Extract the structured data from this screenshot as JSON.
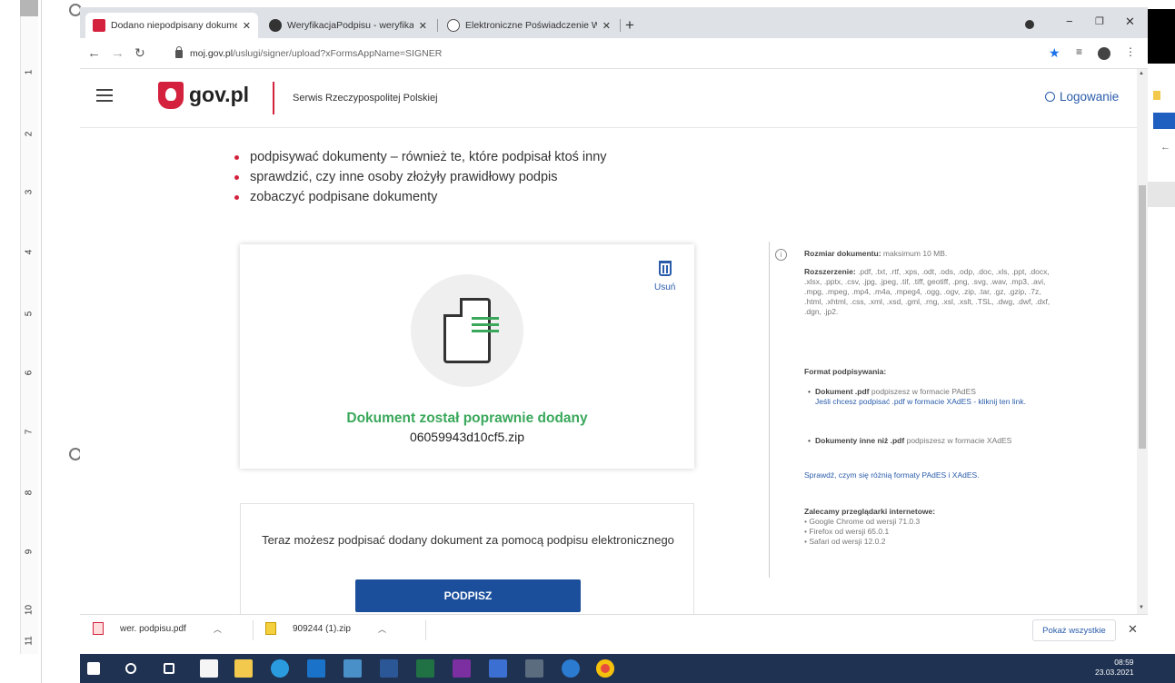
{
  "ruler": {
    "numbers": [
      "1",
      "2",
      "3",
      "4",
      "5",
      "6",
      "7",
      "8",
      "9",
      "10",
      "11"
    ]
  },
  "browser": {
    "tabs": [
      {
        "title": "Dodano niepodpisany dokument",
        "close": "✕",
        "favicon_color": "#d4213d"
      },
      {
        "title": "WeryfikacjaPodpisu - weryfikacja",
        "close": "✕",
        "favicon_color": "#333333"
      },
      {
        "title": "Elektroniczne Poświadczenie Wa",
        "close": "✕",
        "favicon_color": "#555555"
      }
    ],
    "new_tab": "+",
    "window_controls": {
      "minimize": "−",
      "maximize": "❐",
      "close": "✕"
    },
    "url_host": "moj.gov.pl",
    "url_path": "/uslugi/signer/upload?xFormsAppName=SIGNER"
  },
  "site": {
    "logo_text": "gov.pl",
    "subtitle": "Serwis Rzeczypospolitej Polskiej",
    "login_label": "Logowanie",
    "brand_red": "#d4213d",
    "link_blue": "#2a5caa"
  },
  "intro_bullets": [
    "podpisywać dokumenty – również te, które podpisał ktoś inny",
    "sprawdzić, czy inne osoby złożyły prawidłowy podpis",
    "zobaczyć podpisane dokumenty"
  ],
  "upload": {
    "delete_label": "Usuń",
    "success_text": "Dokument został poprawnie dodany",
    "file_name": "06059943d10cf5.zip",
    "success_color": "#3aa85b"
  },
  "sign": {
    "text": "Teraz możesz podpisać dodany dokument za pomocą podpisu elektronicznego",
    "button_label": "PODPISZ",
    "button_color": "#1b4f9b"
  },
  "info": {
    "size_label": "Rozmiar dokumentu:",
    "size_value": "maksimum 10 MB.",
    "ext_label": "Rozszerzenie:",
    "ext_value": ".pdf, .txt, .rtf, .xps, .odt, .ods, .odp, .doc, .xls, .ppt, .docx, .xlsx, .pptx, .csv, .jpg, .jpeg, .tif, .tiff, geotiff, .png, .svg, .wav, .mp3, .avi, .mpg, .mpeg, .mp4, .m4a, .mpeg4, .ogg, .ogv, .zip, .tar, .gz, .gzip, .7z, .html, .xhtml, .css, .xml, .xsd, .gml, .rng, .xsl, .xslt, .TSL, .dwg, .dwf, .dxf, .dgn, .jp2.",
    "format_title": "Format podpisywania:",
    "pdf_bold": "Dokument .pdf",
    "pdf_rest": "podpiszesz w formacie PAdES",
    "pdf_link": "Jeśli chcesz podpisać .pdf w formacie XAdES - kliknij ten link.",
    "other_bold": "Dokumenty inne niż .pdf",
    "other_rest": "podpiszesz w formacie XAdES",
    "compare_link": "Sprawdź, czym się różnią formaty PAdES i XAdES.",
    "browsers_title": "Zalecamy przeglądarki internetowe:",
    "browsers": [
      "• Google Chrome od wersji 71.0.3",
      "• Firefox od wersji 65.0.1",
      "• Safari od wersji 12.0.2"
    ]
  },
  "downloads": {
    "items": [
      {
        "name": "wer. podpisu.pdf",
        "icon_color": "#d4213d"
      },
      {
        "name": "909244 (1).zip",
        "icon_color": "#e8b300"
      }
    ],
    "show_all": "Pokaż wszystkie",
    "close": "✕"
  },
  "taskbar": {
    "time": "08:59",
    "date": "23.03.2021",
    "color": "#1f3251"
  }
}
